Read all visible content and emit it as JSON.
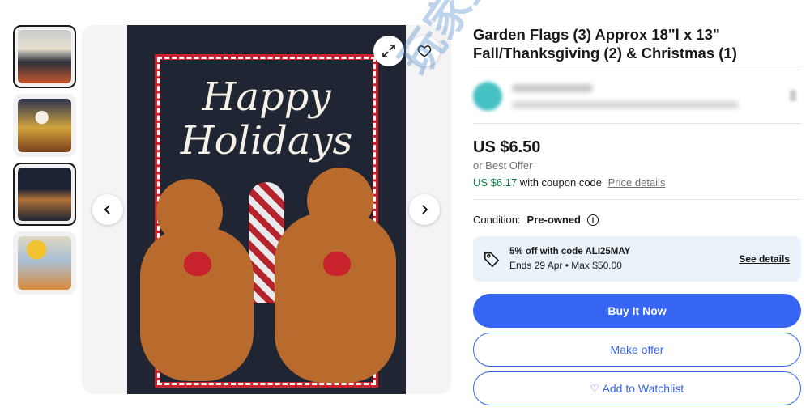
{
  "listing": {
    "title": "Garden Flags (3) Approx 18\"l x 13\" Fall/Thanksgiving (2) & Christmas (1)",
    "price": "US $6.50",
    "best_offer": "or Best Offer",
    "coupon_price": "US $6.17",
    "coupon_text": "with coupon code",
    "price_details": "Price details",
    "condition_label": "Condition:",
    "condition_value": "Pre-owned"
  },
  "gallery": {
    "flag_text": "Happy Holidays",
    "thumbnails": [
      "thumbnail-1",
      "thumbnail-2",
      "thumbnail-3",
      "thumbnail-4"
    ],
    "selected_index": 3
  },
  "promo": {
    "line1": "5% off with code ALI25MAY",
    "line2": "Ends 29 Apr • Max $50.00",
    "see_details": "See details"
  },
  "actions": {
    "buy_now": "Buy It Now",
    "make_offer": "Make offer",
    "watchlist": "Add to Watchlist"
  },
  "watermark": "玩家星球",
  "colors": {
    "primary_blue": "#3665f3",
    "coupon_green": "#05823f",
    "promo_bg": "#eaf3fa"
  },
  "icons": [
    "expand-icon",
    "heart-icon",
    "chevron-left-icon",
    "chevron-right-icon",
    "tag-icon",
    "info-icon"
  ]
}
